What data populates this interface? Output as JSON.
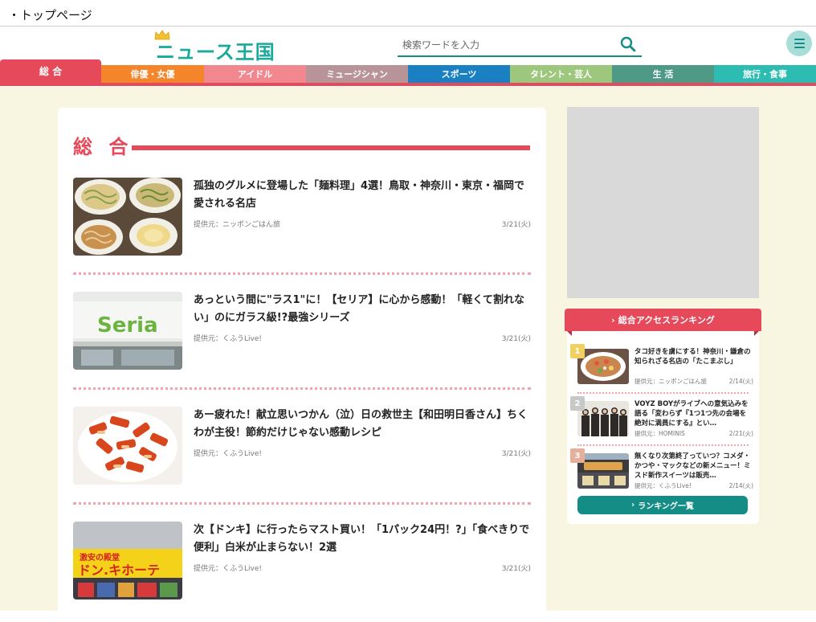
{
  "page_caption": "・トップページ",
  "header": {
    "logo_text": "ニュース王国",
    "search_placeholder": "検索ワードを入力"
  },
  "nav": {
    "tabs": [
      {
        "label": "総 合",
        "color": "#e5495a",
        "active": true
      },
      {
        "label": "俳優・女優",
        "color": "#f5852a"
      },
      {
        "label": "アイドル",
        "color": "#f2888f"
      },
      {
        "label": "ミュージシャン",
        "color": "#b89499"
      },
      {
        "label": "スポーツ",
        "color": "#1a80c2"
      },
      {
        "label": "タレント・芸人",
        "color": "#9cc77c"
      },
      {
        "label": "生 活",
        "color": "#4e9a86"
      },
      {
        "label": "旅行・食事",
        "color": "#2cbcb1"
      }
    ]
  },
  "main": {
    "section_title": "総 合",
    "articles": [
      {
        "title": "孤独のグルメに登場した「麺料理」4選！鳥取・神奈川・東京・福岡で愛される名店",
        "source": "提供元：ニッポンごはん旅",
        "date": "3/21(火)"
      },
      {
        "title": "あっという間に\"ラス1\"に！【セリア】に心から感動！「軽くて割れない」のにガラス級!?最強シリーズ",
        "source": "提供元：くふうLive!",
        "date": "3/21(火)",
        "thumb_text": "Seria"
      },
      {
        "title": "あー疲れた！献立思いつかん（泣）日の救世主【和田明日香さん】ちくわが主役！節約だけじゃない感動レシピ",
        "source": "提供元：くふうLive!",
        "date": "3/21(火)"
      },
      {
        "title": "次【ドンキ】に行ったらマスト買い！「1パック24円！?」「食べきりで便利」白米が止まらない！2選",
        "source": "提供元：くふうLive!",
        "date": "3/21(火)",
        "thumb_text": "ドン.キホーテ",
        "thumb_subtext": "激安の殿堂"
      }
    ]
  },
  "ranking": {
    "header": "総合アクセスランキング",
    "items": [
      {
        "rank": "1",
        "title": "タコ好きを虜にする！神奈川・鎌倉の知られざる名店の「たこまぶし」",
        "source": "提供元：ニッポンごはん旅",
        "date": "2/14(火)",
        "badge_color": "#f0d060"
      },
      {
        "rank": "2",
        "title": "VOYZ BOYがライブへの意気込みを語る「変わらず『1つ1つ先の会場を絶対に満員にする』とい…",
        "source": "提供元：HOMINIS",
        "date": "2/21(火)",
        "badge_color": "#c8c8c8"
      },
      {
        "rank": "3",
        "title": "無くなり次第終了っていつ？コメダ・かつや・マックなどの新メニュー！ミスド新作スイーツは販売…",
        "source": "提供元：くふうLive!",
        "date": "2/14(火)",
        "badge_color": "#e4b09a"
      }
    ],
    "button_label": "ランキング一覧"
  }
}
